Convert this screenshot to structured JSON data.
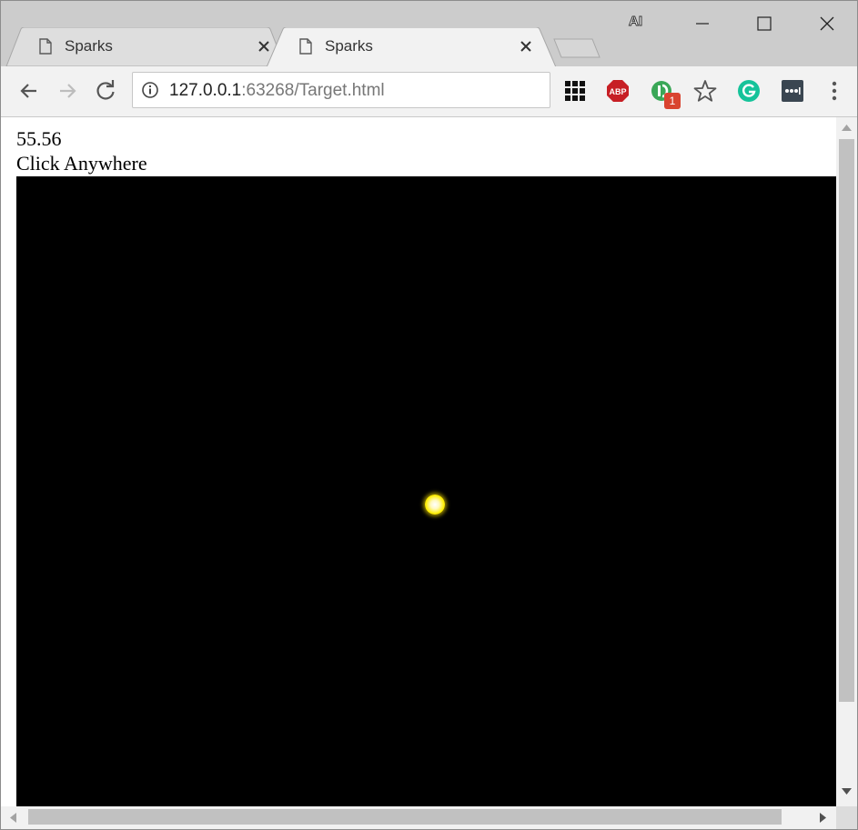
{
  "browser": {
    "tabs": [
      {
        "title": "Sparks",
        "active": false
      },
      {
        "title": "Sparks",
        "active": true
      }
    ],
    "profile_label": "AI",
    "address": {
      "host": "127.0.0.1",
      "rest": ":63268/Target.html"
    },
    "extensions": {
      "inbox_badge": "1"
    },
    "colors": {
      "tabstrip": "#cccccc",
      "toolbar": "#f2f2f2",
      "abp_red": "#c71f25",
      "grammarly_green": "#15c39a",
      "inbox_green": "#3aa757"
    }
  },
  "page": {
    "score": "55.56",
    "hint": "Click Anywhere",
    "canvas_color": "#000000",
    "target_color": "#ffee00"
  }
}
